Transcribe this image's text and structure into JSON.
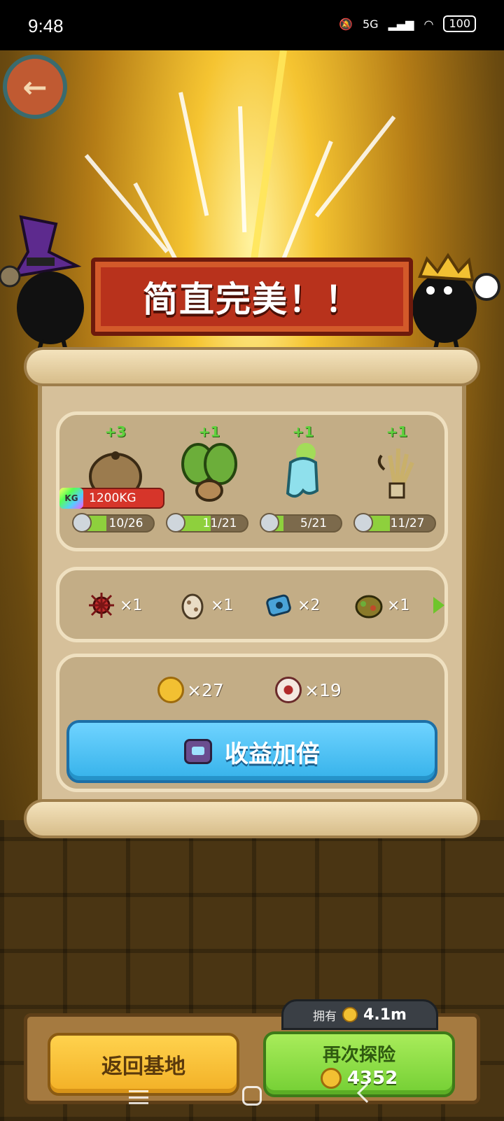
{
  "status_bar": {
    "time": "9:48",
    "network": "5G",
    "battery": "100"
  },
  "banner": {
    "title": "简直完美！！"
  },
  "plants": [
    {
      "name": "burlap-sack-plant",
      "bonus": "+3",
      "count": "10/26",
      "progress": 0.38,
      "weight": "1200KG",
      "kg_icon": "KG"
    },
    {
      "name": "cactus-mandrake",
      "bonus": "+1",
      "count": "11/21",
      "progress": 0.52
    },
    {
      "name": "ghost-radish",
      "bonus": "+1",
      "count": "5/21",
      "progress": 0.24
    },
    {
      "name": "wheat-bundle",
      "bonus": "+1",
      "count": "11/27",
      "progress": 0.41
    }
  ],
  "items": [
    {
      "name": "spiky-red-mite-icon",
      "qty": "×1"
    },
    {
      "name": "speckled-egg-icon",
      "qty": "×1"
    },
    {
      "name": "blue-gear-ore-icon",
      "qty": "×2"
    },
    {
      "name": "mossy-rock-icon",
      "qty": "×1"
    }
  ],
  "rewards": [
    {
      "name": "gold-coin-icon",
      "qty": "×27"
    },
    {
      "name": "eyeball-icon",
      "qty": "×19"
    }
  ],
  "double_button": {
    "label": "收益加倍"
  },
  "bottom": {
    "balance_label": "拥有",
    "balance_value": "4.1m",
    "home_label": "返回基地",
    "again_label": "再次探险",
    "again_cost": "4352"
  },
  "colors": {
    "banner_red": "#b8321c",
    "double_blue": "#35b2ea",
    "again_green": "#74cf34",
    "home_yellow": "#f2b026",
    "progress_green": "#8ed03d"
  }
}
